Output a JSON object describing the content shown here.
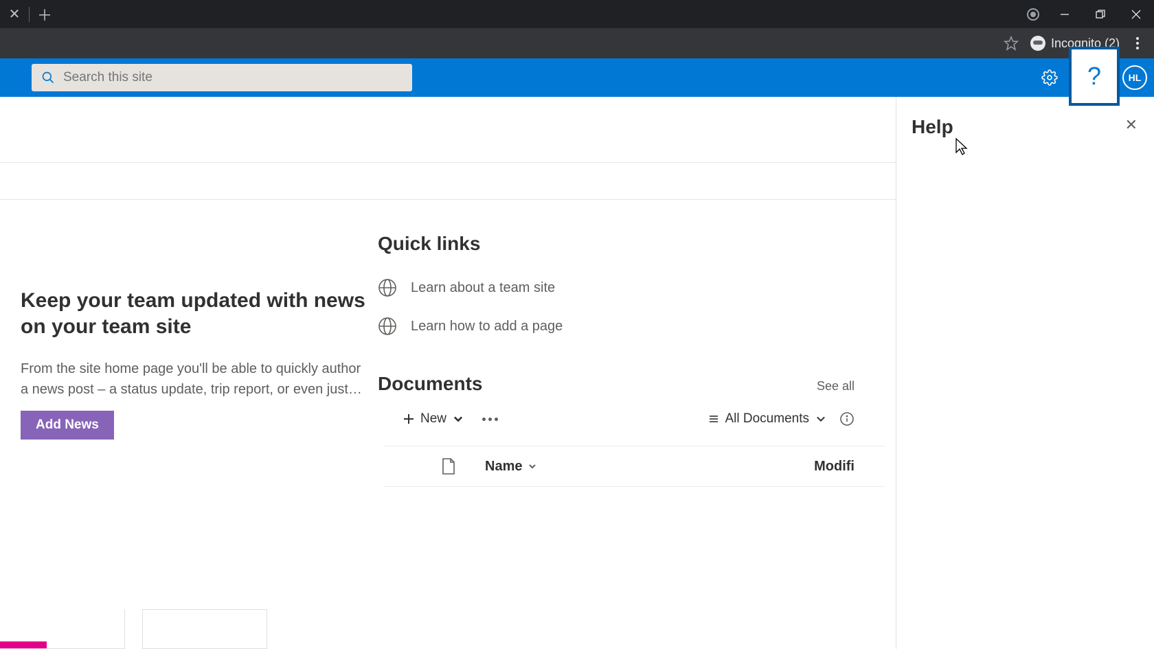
{
  "browser": {
    "incognito_label": "Incognito (2)"
  },
  "suitebar": {
    "search_placeholder": "Search this site",
    "avatar_initials": "HL"
  },
  "help_panel": {
    "title": "Help"
  },
  "news": {
    "title": "Keep your team updated with news on your team site",
    "body": "From the site home page you'll be able to quickly author a news post – a status update, trip report, or even just…",
    "button_label": "Add News"
  },
  "quicklinks": {
    "heading": "Quick links",
    "items": [
      {
        "label": "Learn about a team site"
      },
      {
        "label": "Learn how to add a page"
      }
    ]
  },
  "documents": {
    "heading": "Documents",
    "see_all": "See all",
    "toolbar": {
      "new_label": "New",
      "view_label": "All Documents"
    },
    "columns": {
      "name": "Name",
      "modified": "Modifi"
    }
  }
}
